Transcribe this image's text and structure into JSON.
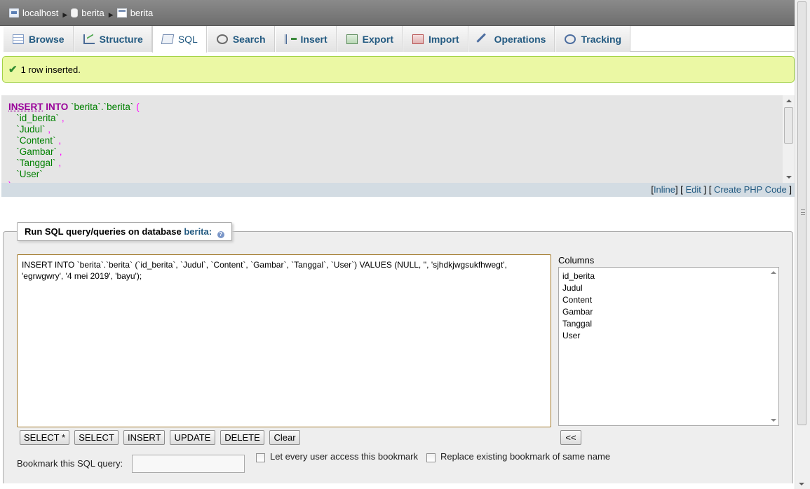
{
  "breadcrumb": {
    "server": "localhost",
    "database": "berita",
    "table": "berita"
  },
  "tabs": [
    {
      "label": "Browse",
      "icon": "browse-icon"
    },
    {
      "label": "Structure",
      "icon": "structure-icon"
    },
    {
      "label": "SQL",
      "icon": "sql-icon",
      "active": true
    },
    {
      "label": "Search",
      "icon": "search-icon"
    },
    {
      "label": "Insert",
      "icon": "insert-icon"
    },
    {
      "label": "Export",
      "icon": "export-icon"
    },
    {
      "label": "Import",
      "icon": "import-icon"
    },
    {
      "label": "Operations",
      "icon": "wrench-icon"
    },
    {
      "label": "Tracking",
      "icon": "eye-icon"
    }
  ],
  "message": "1 row inserted.",
  "sql_display": {
    "lines": [
      [
        {
          "t": "INSERT",
          "c": "kw u"
        },
        {
          "t": " "
        },
        {
          "t": "INTO",
          "c": "kw"
        },
        {
          "t": " "
        },
        {
          "t": "`berita`",
          "c": "id"
        },
        {
          "t": ".",
          "c": "id"
        },
        {
          "t": "`berita`",
          "c": "id"
        },
        {
          "t": " "
        },
        {
          "t": "(",
          "c": "pn"
        }
      ],
      [
        {
          "t": "   "
        },
        {
          "t": "`id_berita`",
          "c": "id"
        },
        {
          "t": " "
        },
        {
          "t": ",",
          "c": "pn"
        }
      ],
      [
        {
          "t": "   "
        },
        {
          "t": "`Judul`",
          "c": "id"
        },
        {
          "t": " "
        },
        {
          "t": ",",
          "c": "pn"
        }
      ],
      [
        {
          "t": "   "
        },
        {
          "t": "`Content`",
          "c": "id"
        },
        {
          "t": " "
        },
        {
          "t": ",",
          "c": "pn"
        }
      ],
      [
        {
          "t": "   "
        },
        {
          "t": "`Gambar`",
          "c": "id"
        },
        {
          "t": " "
        },
        {
          "t": ",",
          "c": "pn"
        }
      ],
      [
        {
          "t": "   "
        },
        {
          "t": "`Tanggal`",
          "c": "id"
        },
        {
          "t": " "
        },
        {
          "t": ",",
          "c": "pn"
        }
      ],
      [
        {
          "t": "   "
        },
        {
          "t": "`User`",
          "c": "id"
        }
      ],
      [
        {
          "t": ")",
          "c": "pn"
        }
      ]
    ]
  },
  "sql_links": {
    "inline": "Inline",
    "edit": "Edit",
    "create_php": "Create PHP Code"
  },
  "query_panel": {
    "legend_prefix": "Run SQL query/queries on database",
    "legend_db": "berita:",
    "query_text": "INSERT INTO `berita`.`berita` (`id_berita`, `Judul`, `Content`, `Gambar`, `Tanggal`, `User`) VALUES (NULL, '', 'sjhdkjwgsukfhwegt', 'egrwgwry', '4 mei 2019', 'bayu');",
    "columns_label": "Columns",
    "columns": [
      "id_berita",
      "Judul",
      "Content",
      "Gambar",
      "Tanggal",
      "User"
    ],
    "buttons": {
      "select_star": "SELECT *",
      "select": "SELECT",
      "insert": "INSERT",
      "update": "UPDATE",
      "delete": "DELETE",
      "clear": "Clear",
      "insert_column": "<<"
    },
    "bookmark_label": "Bookmark this SQL query:",
    "bookmark_value": "",
    "let_every_user": "Let every user access this bookmark",
    "replace_existing": "Replace existing bookmark of same name"
  }
}
